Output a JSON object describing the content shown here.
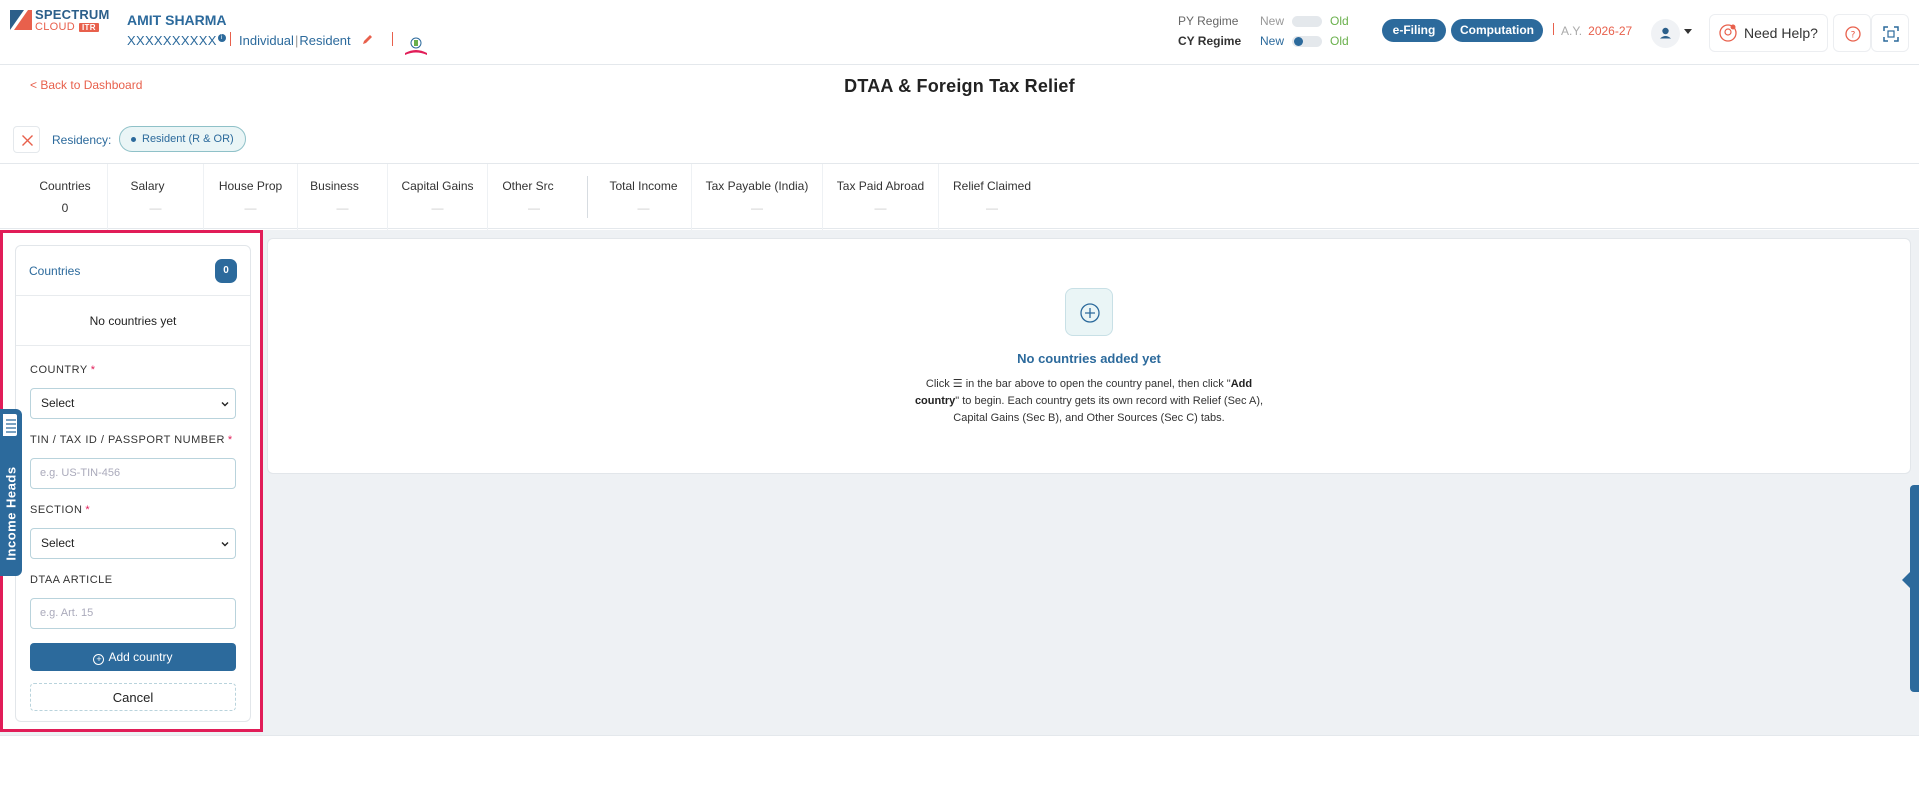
{
  "header": {
    "logo_word": "SPECTRUM",
    "logo_sub": "CLOUD",
    "logo_badge": "ITR",
    "user_name": "AMIT SHARMA",
    "user_pan": "XXXXXXXXXX",
    "pan_info": "i",
    "user_category": "Individual",
    "user_residency": "Resident",
    "regimes": {
      "py": {
        "label": "PY Regime",
        "new": "New",
        "old": "Old"
      },
      "cy": {
        "label": "CY Regime",
        "new": "New",
        "old": "Old"
      }
    },
    "efiling_label": "e-Filing",
    "computation_label": "Computation",
    "ay_label": "A.Y.",
    "ay_value": "2026-27",
    "help_label": "Need Help?"
  },
  "page": {
    "back_label": "< Back to Dashboard",
    "title": "DTAA & Foreign Tax Relief"
  },
  "residency": {
    "label": "Residency:",
    "value": "Resident (R & OR)"
  },
  "summary": {
    "cells": [
      {
        "label": "Countries",
        "value": "0"
      },
      {
        "label": "Salary",
        "value": "—"
      },
      {
        "label": "House Prop",
        "value": "—"
      },
      {
        "label": "Business",
        "value": "—"
      },
      {
        "label": "Capital Gains",
        "value": "—"
      },
      {
        "label": "Other Src",
        "value": "—"
      },
      {
        "label": "Total Income",
        "value": "—"
      },
      {
        "label": "Tax Payable (India)",
        "value": "—"
      },
      {
        "label": "Tax Paid Abroad",
        "value": "—"
      },
      {
        "label": "Relief Claimed",
        "value": "—"
      }
    ]
  },
  "side_panel": {
    "title": "Countries",
    "count": "0",
    "empty_text": "No countries yet",
    "country_label": "COUNTRY",
    "country_value": "Select",
    "tin_label": "TIN / TAX ID / PASSPORT NUMBER",
    "tin_placeholder": "e.g. US-TIN-456",
    "section_label": "SECTION",
    "section_value": "Select",
    "article_label": "DTAA ARTICLE",
    "article_placeholder": "e.g. Art. 15",
    "required_mark": "*",
    "add_label": "Add country",
    "cancel_label": "Cancel",
    "tab_label": "Income Heads"
  },
  "empty_state": {
    "title": "No countries added yet",
    "desc_pre": "Click ☰ in the bar above to open the country panel, then click \"",
    "desc_bold": "Add country",
    "desc_post": "\" to begin. Each country gets its own record with Relief (Sec A), Capital Gains (Sec B), and Other Sources (Sec C) tabs."
  },
  "colors": {
    "primary": "#2c6a9c",
    "accent": "#e8604c",
    "highlight": "#e11d58",
    "success": "#6ab04c"
  }
}
